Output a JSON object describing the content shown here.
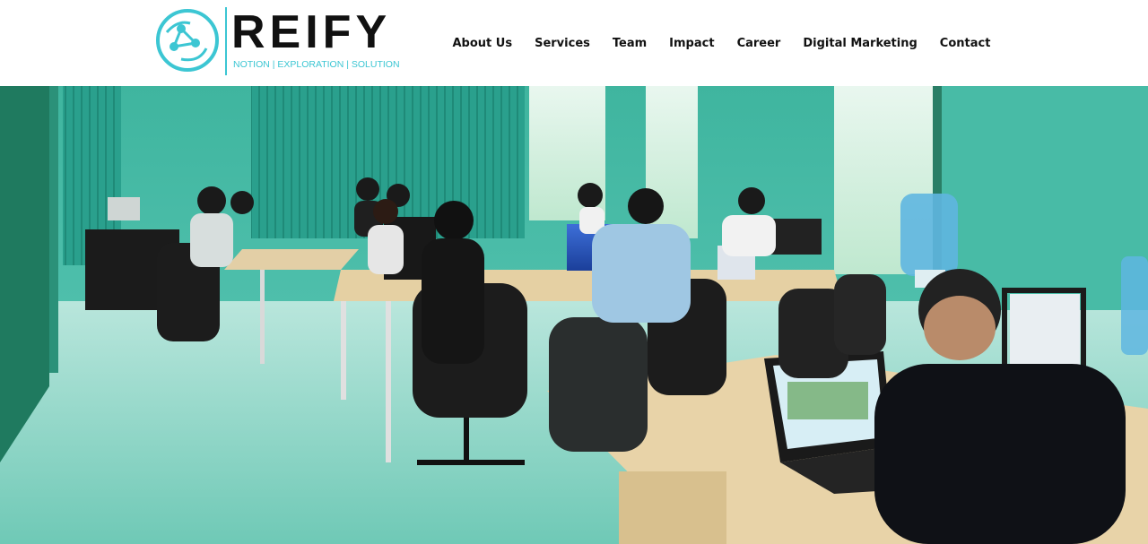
{
  "brand": {
    "name": "REIFY",
    "tagline": "NOTION | EXPLORATION | SOLUTION",
    "logo_icon": "network-nodes-icon",
    "accent_color": "#3cc6d3"
  },
  "nav": {
    "items": [
      {
        "label": "About Us"
      },
      {
        "label": "Services"
      },
      {
        "label": "Team"
      },
      {
        "label": "Impact"
      },
      {
        "label": "Career"
      },
      {
        "label": "Digital Marketing"
      },
      {
        "label": "Contact"
      }
    ]
  },
  "hero": {
    "image_subject": "office-workspace-photo"
  }
}
